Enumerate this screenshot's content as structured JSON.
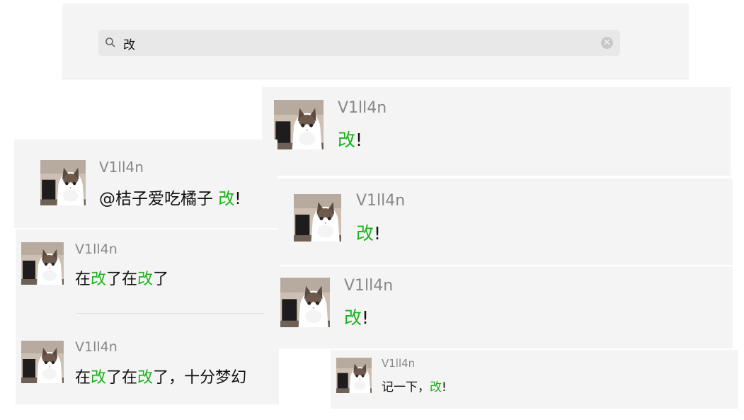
{
  "search": {
    "query": "改",
    "highlight_color": "#19b219"
  },
  "results": [
    {
      "user": "V1ll4n",
      "segments": [
        {
          "t": "改",
          "hl": true
        },
        {
          "t": "!",
          "hl": false
        }
      ]
    },
    {
      "user": "V1ll4n",
      "segments": [
        {
          "t": "@桔子爱吃橘子 ",
          "hl": false
        },
        {
          "t": "改",
          "hl": true
        },
        {
          "t": "!",
          "hl": false
        }
      ]
    },
    {
      "user": "V1ll4n",
      "segments": [
        {
          "t": "改",
          "hl": true
        },
        {
          "t": "!",
          "hl": false
        }
      ]
    },
    {
      "user": "V1ll4n",
      "segments": [
        {
          "t": "在",
          "hl": false
        },
        {
          "t": "改",
          "hl": true
        },
        {
          "t": "了在",
          "hl": false
        },
        {
          "t": "改",
          "hl": true
        },
        {
          "t": "了",
          "hl": false
        }
      ]
    },
    {
      "user": "V1ll4n",
      "segments": [
        {
          "t": "改",
          "hl": true
        },
        {
          "t": "!",
          "hl": false
        }
      ]
    },
    {
      "user": "V1ll4n",
      "segments": [
        {
          "t": "在",
          "hl": false
        },
        {
          "t": "改",
          "hl": true
        },
        {
          "t": "了在",
          "hl": false
        },
        {
          "t": "改",
          "hl": true
        },
        {
          "t": "了，十分梦幻",
          "hl": false
        }
      ]
    },
    {
      "user": "V1ll4n",
      "segments": [
        {
          "t": "记一下，",
          "hl": false
        },
        {
          "t": "改",
          "hl": true
        },
        {
          "t": "!",
          "hl": false
        }
      ]
    }
  ]
}
